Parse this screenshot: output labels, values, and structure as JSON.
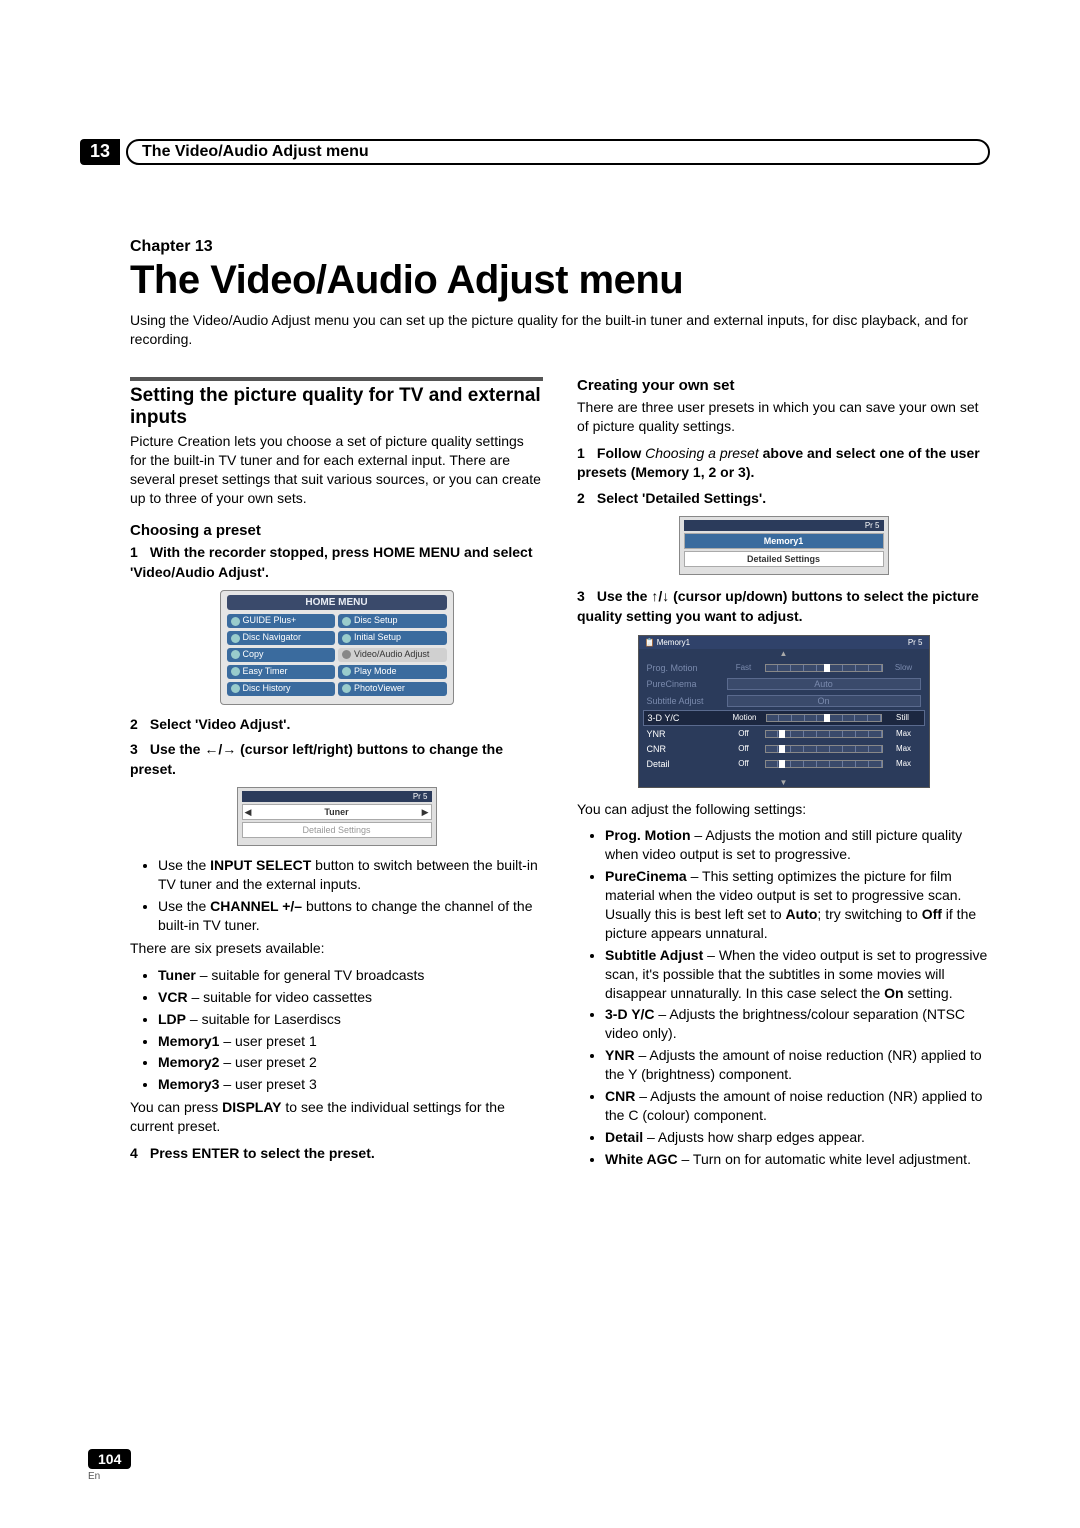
{
  "header": {
    "chapter_number": "13",
    "running_title": "The Video/Audio Adjust menu"
  },
  "title_block": {
    "chapter_label": "Chapter 13",
    "main_title": "The Video/Audio Adjust menu",
    "intro": "Using the Video/Audio Adjust menu you can set up the picture quality for the built-in tuner and external inputs, for disc playback, and for recording."
  },
  "left": {
    "section_title": "Setting the picture quality for TV and external inputs",
    "section_intro": "Picture Creation lets you choose a set of picture quality settings for the built-in TV tuner and for each external input. There are several preset settings that suit various sources, or you can create up to three of your own sets.",
    "sub1_title": "Choosing a preset",
    "step1_num": "1",
    "step1_text": "With the recorder stopped, press HOME MENU and select 'Video/Audio Adjust'.",
    "homemenu": {
      "title": "HOME MENU",
      "items_left": [
        "GUIDE Plus+",
        "Disc Navigator",
        "Copy",
        "Easy Timer",
        "Disc History"
      ],
      "items_right": [
        "Disc Setup",
        "Initial Setup",
        "Video/Audio Adjust",
        "Play Mode",
        "PhotoViewer"
      ]
    },
    "step2_num": "2",
    "step2_text": "Select 'Video Adjust'.",
    "step3_num": "3",
    "step3_pre": "Use the ",
    "step3_arrows": "←/→",
    "step3_post": " (cursor left/right) buttons to change the preset.",
    "tuner_fig": {
      "badge": "Pr 5",
      "row1": "Tuner",
      "row2": "Detailed Settings"
    },
    "tips": [
      {
        "pre": "Use the ",
        "b": "INPUT SELECT",
        "post": " button to switch between the built-in TV tuner and the external inputs."
      },
      {
        "pre": "Use the ",
        "b": "CHANNEL +/–",
        "post": " buttons to change the channel of the built-in TV tuner."
      }
    ],
    "presets_intro": "There are six presets available:",
    "presets": [
      {
        "b": "Tuner",
        "t": " – suitable for general TV broadcasts"
      },
      {
        "b": "VCR",
        "t": " – suitable for video cassettes"
      },
      {
        "b": "LDP",
        "t": " – suitable for Laserdiscs"
      },
      {
        "b": "Memory1",
        "t": " – user preset 1"
      },
      {
        "b": "Memory2",
        "t": " – user preset 2"
      },
      {
        "b": "Memory3",
        "t": " – user preset 3"
      }
    ],
    "display_line_pre": "You can press ",
    "display_line_b": "DISPLAY",
    "display_line_post": " to see the individual settings for the current preset.",
    "step4_num": "4",
    "step4_text": "Press ENTER to select the preset."
  },
  "right": {
    "sub_title": "Creating your own set",
    "intro": "There are three user presets in which you can save your own set of picture quality settings.",
    "step1_num": "1",
    "step1_pre": "Follow ",
    "step1_i": "Choosing a preset",
    "step1_post": " above and select one of the user presets (Memory 1, 2 or 3).",
    "step2_num": "2",
    "step2_text": "Select 'Detailed Settings'.",
    "mem_fig": {
      "badge": "Pr 5",
      "row1": "Memory1",
      "row2": "Detailed Settings"
    },
    "step3_num": "3",
    "step3_pre": "Use the ",
    "step3_arrows": "↑/↓",
    "step3_post": " (cursor up/down) buttons to select the picture quality setting you want to adjust.",
    "det_fig": {
      "hdr_left": "Memory1",
      "hdr_right": "Pr 5",
      "rows": [
        {
          "label": "Prog. Motion",
          "l": "Fast",
          "r": "Slow",
          "dim": true,
          "knob": 50
        },
        {
          "label": "PureCinema",
          "center": "Auto",
          "dim": true
        },
        {
          "label": "Subtitle Adjust",
          "center": "On",
          "dim": true
        },
        {
          "label": "3-D Y/C",
          "l": "Motion",
          "r": "Still",
          "knob": 50,
          "act": true
        },
        {
          "label": "YNR",
          "l": "Off",
          "r": "Max",
          "knob": 12
        },
        {
          "label": "CNR",
          "l": "Off",
          "r": "Max",
          "knob": 12
        },
        {
          "label": "Detail",
          "l": "Off",
          "r": "Max",
          "knob": 12
        }
      ]
    },
    "adjust_intro": "You can adjust the following settings:",
    "settings": [
      {
        "b": "Prog. Motion",
        "t": " – Adjusts the motion and still picture quality when video output is set to progressive."
      },
      {
        "b": "PureCinema",
        "t": " –  This setting optimizes the picture for film material when the video output is set to progressive scan. Usually this is best left set to ",
        "b2": "Auto",
        "t2": "; try switching to ",
        "b3": "Off",
        "t3": " if the picture appears unnatural."
      },
      {
        "b": "Subtitle Adjust",
        "t": " – When the video output is set to progressive scan, it's possible that the subtitles in some movies will disappear unnaturally. In this case select the ",
        "b2": "On",
        "t2": " setting."
      },
      {
        "b": "3-D Y/C",
        "t": " – Adjusts the brightness/colour separation (NTSC video only)."
      },
      {
        "b": "YNR",
        "t": " – Adjusts the amount of noise reduction (NR) applied to the Y (brightness) component."
      },
      {
        "b": "CNR",
        "t": " – Adjusts the amount of noise reduction (NR) applied to the C (colour) component."
      },
      {
        "b": "Detail",
        "t": " – Adjusts how sharp edges appear."
      },
      {
        "b": "White AGC",
        "t": " – Turn on for automatic white level adjustment."
      }
    ]
  },
  "footer": {
    "page": "104",
    "lang": "En"
  }
}
